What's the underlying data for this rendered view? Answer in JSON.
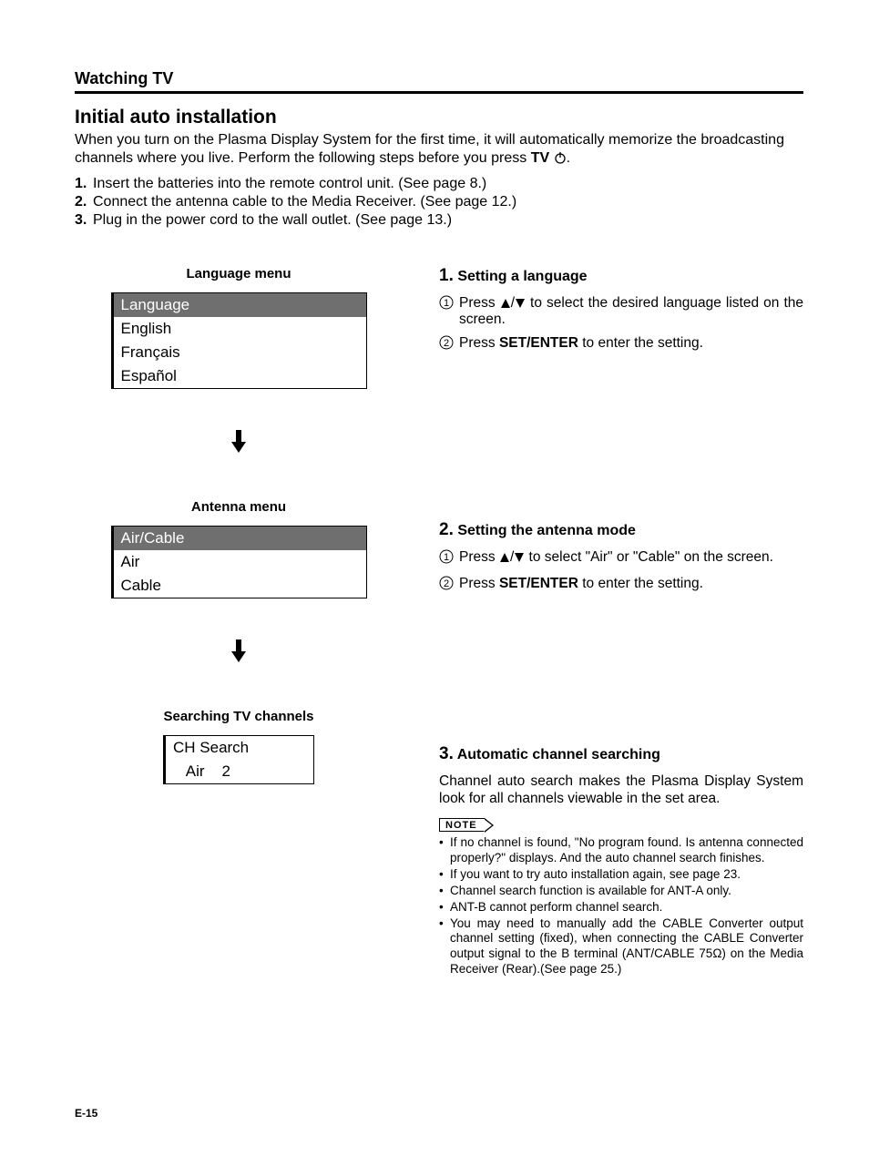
{
  "section_header": "Watching TV",
  "title": "Initial auto installation",
  "intro": {
    "p1a": "When you turn on the Plasma Display System for the first time, it will automatically memorize the broadcasting channels where you live. Perform the following steps before you press ",
    "tv": "TV",
    "p1b": "."
  },
  "steps_pre": {
    "s1": {
      "n": "1.",
      "t": "Insert the batteries into the remote control unit. (See page 8.)"
    },
    "s2": {
      "n": "2.",
      "t": "Connect the antenna cable to the Media Receiver. (See page 12.)"
    },
    "s3": {
      "n": "3.",
      "t": "Plug in the power cord to the wall outlet. (See page 13.)"
    }
  },
  "left": {
    "lang_label": "Language menu",
    "lang_hdr": "Language",
    "lang_items": [
      "English",
      "Français",
      "Español"
    ],
    "ant_label": "Antenna menu",
    "ant_hdr": "Air/Cable",
    "ant_items": [
      "Air",
      "Cable"
    ],
    "search_label": "Searching TV channels",
    "search_hdr": "CH Search",
    "search_item": " Air    2"
  },
  "right": {
    "s1": {
      "num": "1.",
      "title": "Setting a language",
      "sub1a": "Press ",
      "sub1b": " to select the desired language listed on the screen.",
      "sub2a": "Press ",
      "sub2b": "SET/ENTER",
      "sub2c": " to enter the setting."
    },
    "s2": {
      "num": "2.",
      "title": "Setting the antenna mode",
      "sub1a": "Press ",
      "sub1b": " to select \"Air\" or \"Cable\" on the screen.",
      "sub2a": "Press ",
      "sub2b": "SET/ENTER",
      "sub2c": " to enter the setting."
    },
    "s3": {
      "num": "3.",
      "title": "Automatic channel searching",
      "para": "Channel auto search makes the Plasma Display System look for all channels viewable in the set area.",
      "note_label": "NOTE",
      "notes": [
        "If no channel is found, \"No program found. Is antenna connected properly?\" displays. And the auto channel search finishes.",
        "If you want to try auto installation again, see page 23.",
        "Channel search function is available for ANT-A only.",
        "ANT-B cannot perform channel search.",
        "You may need to manually add the CABLE Converter output channel setting (fixed), when connecting the CABLE Converter output signal to the B terminal (ANT/CABLE 75Ω) on the Media Receiver (Rear).(See page 25.)"
      ]
    }
  },
  "page_num": "E-15"
}
